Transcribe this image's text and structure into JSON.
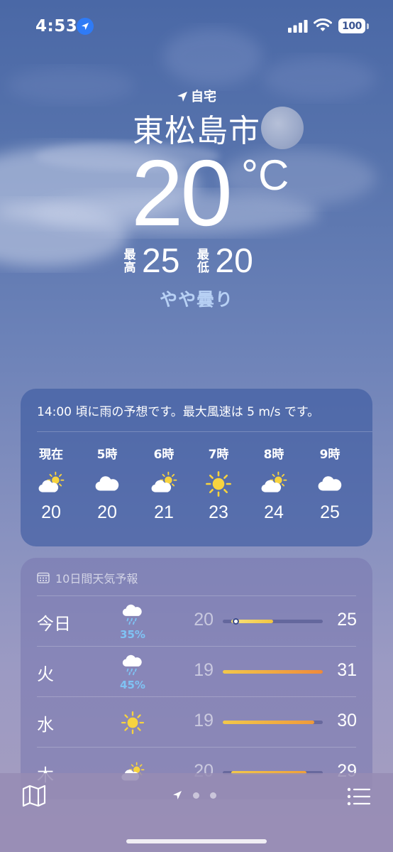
{
  "status_bar": {
    "time": "4:53",
    "battery": "100",
    "location_icon": "location-arrow-icon"
  },
  "header": {
    "home_label": "自宅",
    "city": "東松島市",
    "temperature": "20",
    "unit": "°C",
    "high_label": "最高",
    "high": "25",
    "low_label": "最低",
    "low": "20",
    "condition": "やや曇り"
  },
  "hourly": {
    "summary": "14:00 頃に雨の予想です。最大風速は 5 m/s です。",
    "hours": [
      {
        "label": "現在",
        "icon": "partly-sunny-icon",
        "temp": "20"
      },
      {
        "label": "5時",
        "icon": "cloud-icon",
        "temp": "20"
      },
      {
        "label": "6時",
        "icon": "partly-sunny-icon",
        "temp": "21"
      },
      {
        "label": "7時",
        "icon": "sun-icon",
        "temp": "23"
      },
      {
        "label": "8時",
        "icon": "partly-sunny-icon",
        "temp": "24"
      },
      {
        "label": "9時",
        "icon": "cloud-icon",
        "temp": "25"
      }
    ]
  },
  "daily": {
    "header": "10日間天気予報",
    "range_min": 19,
    "range_max": 31,
    "days": [
      {
        "name": "今日",
        "icon": "rain-cloud-icon",
        "precip": "35%",
        "low": "20",
        "high": "25",
        "current": 20,
        "colors": [
          "#f7e27a",
          "#f2c542"
        ]
      },
      {
        "name": "火",
        "icon": "rain-cloud-icon",
        "precip": "45%",
        "low": "19",
        "high": "31",
        "colors": [
          "#f2c84b",
          "#ef8a3a"
        ]
      },
      {
        "name": "水",
        "icon": "sun-icon",
        "precip": "",
        "low": "19",
        "high": "30",
        "colors": [
          "#f2c84b",
          "#ef9a3a"
        ]
      },
      {
        "name": "木",
        "icon": "partly-sunny-icon",
        "precip": "",
        "low": "20",
        "high": "29",
        "colors": [
          "#f2c84b",
          "#efa03a"
        ]
      }
    ]
  },
  "bottom_bar": {
    "map_icon": "map-icon",
    "list_icon": "list-icon"
  }
}
